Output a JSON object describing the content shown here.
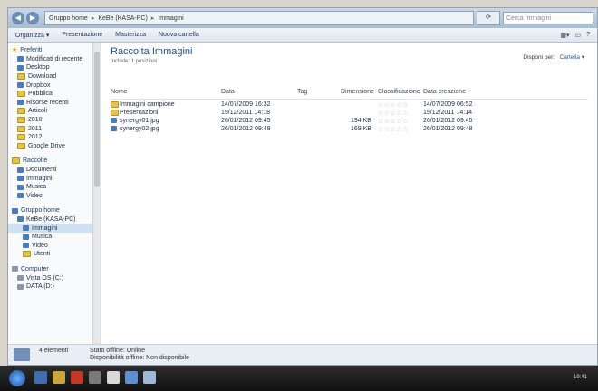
{
  "address": {
    "crumbs": [
      "Gruppo home",
      "KeBe (KASA-PC)",
      "Immagini"
    ],
    "search_placeholder": "Cerca Immagini"
  },
  "toolbar": {
    "items": [
      "Organizza ▾",
      "Presentazione",
      "Masterizza",
      "Nuova cartella"
    ]
  },
  "sidebar": {
    "favorites": {
      "head": "Preferiti",
      "items": [
        "Modificati di recente",
        "Desktop",
        "Download",
        "Dropbox",
        "Pubblica",
        "Risorse recenti",
        "Articoli",
        "2010",
        "2011",
        "2012",
        "Google Drive"
      ]
    },
    "libraries": {
      "head": "Raccolte",
      "items": [
        "Documenti",
        "Immagini",
        "Musica",
        "Video"
      ]
    },
    "homegroup": {
      "head": "Gruppo home",
      "items": [
        "KeBe (KASA-PC)",
        "Immagini",
        "Musica",
        "Video",
        "Utenti"
      ]
    },
    "computer": {
      "head": "Computer",
      "items": [
        "Vista OS (C:)",
        "DATA (D:)"
      ]
    }
  },
  "library": {
    "title": "Raccolta Immagini",
    "subtitle": "Include: 1 posizioni",
    "arrange_label": "Disponi per:",
    "arrange_value": "Cartella ▾"
  },
  "columns": [
    "Nome",
    "Data",
    "Tag",
    "Dimensione",
    "Classificazione",
    "Data creazione"
  ],
  "files": [
    {
      "name": "Immagini campione",
      "date": "14/07/2009 16:32",
      "tag": "",
      "size": "",
      "rating": "☆☆☆☆☆",
      "created": "14/07/2009 06:52"
    },
    {
      "name": "Presentazioni",
      "date": "19/12/2011 14:18",
      "tag": "",
      "size": "",
      "rating": "☆☆☆☆☆",
      "created": "19/12/2011 14:14"
    },
    {
      "name": "synergy01.jpg",
      "date": "26/01/2012 09:45",
      "tag": "",
      "size": "194 KB",
      "rating": "☆☆☆☆☆",
      "created": "26/01/2012 09:45"
    },
    {
      "name": "synergy02.jpg",
      "date": "26/01/2012 09:48",
      "tag": "",
      "size": "169 KB",
      "rating": "☆☆☆☆☆",
      "created": "26/01/2012 09:48"
    }
  ],
  "details": {
    "count": "4 elementi",
    "line1": "Stato offline: Online",
    "line2": "Disponibilità offline: Non disponibile"
  },
  "taskbar": {
    "clock": "19:41"
  }
}
